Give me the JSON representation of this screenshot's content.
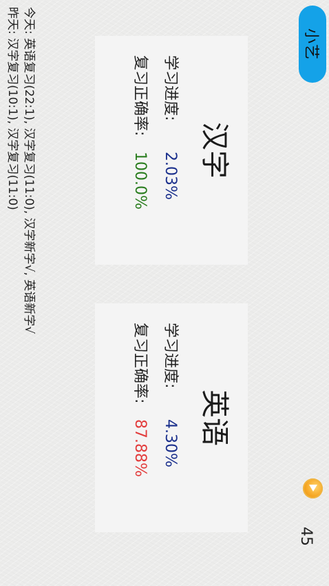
{
  "app_button": {
    "label": "小艺"
  },
  "activity": {
    "today": "今天: 英语复习(22:1), 汉字复习(11:0), 汉字新字√, 英语新字√",
    "yesterday": "昨天: 汉字复习(10:1), 汉字复习(11:0)"
  },
  "coins": {
    "icon": "coin-icon",
    "count": "45"
  },
  "cards": [
    {
      "title": "汉字",
      "progress_label": "学习进度:",
      "progress_value": "2.03%",
      "accuracy_label": "复习正确率:",
      "accuracy_value": "100.0%"
    },
    {
      "title": "英语",
      "progress_label": "学习进度:",
      "progress_value": "4.30%",
      "accuracy_label": "复习正确率:",
      "accuracy_value": "87.88%"
    }
  ],
  "colors": {
    "accent": "#14a2e8",
    "progress": "#1a2f8c",
    "accuracy_good": "#2a7d1f",
    "accuracy_bad": "#e23c3c"
  }
}
